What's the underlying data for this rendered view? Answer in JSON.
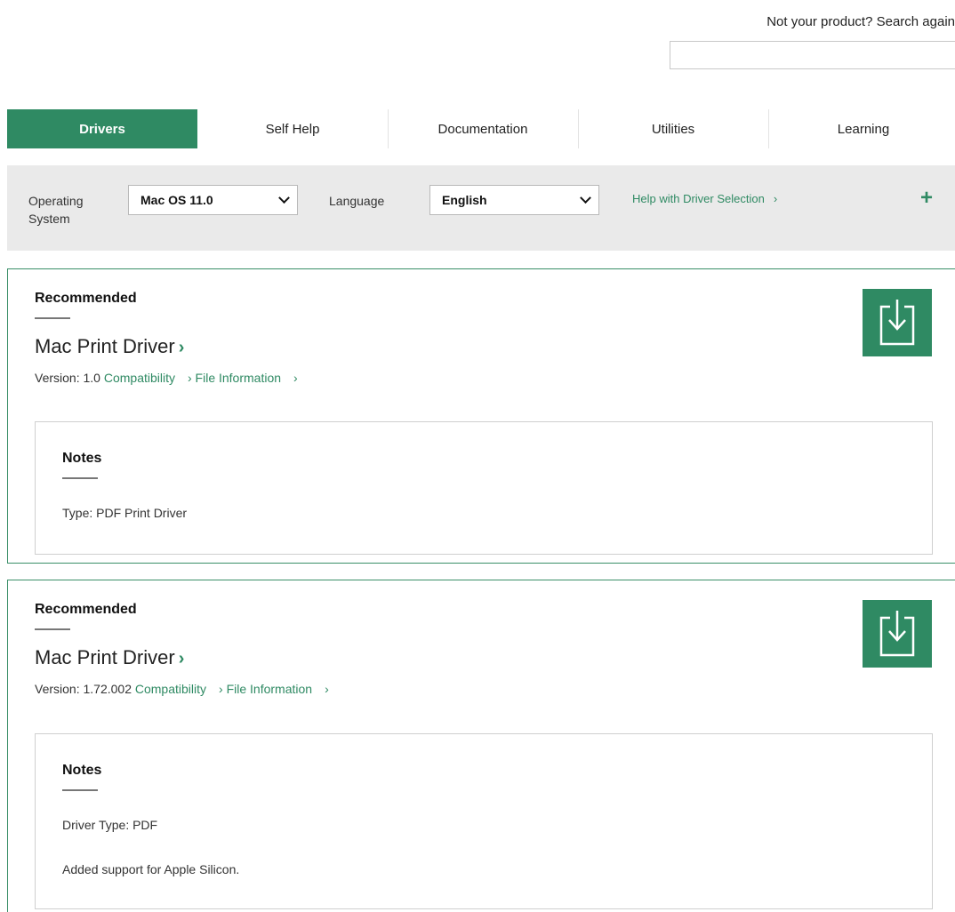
{
  "search": {
    "prompt": "Not your product? Search again",
    "value": ""
  },
  "tabs": [
    {
      "label": "Drivers",
      "active": true
    },
    {
      "label": "Self Help",
      "active": false
    },
    {
      "label": "Documentation",
      "active": false
    },
    {
      "label": "Utilities",
      "active": false
    },
    {
      "label": "Learning",
      "active": false
    }
  ],
  "filters": {
    "os_label": "Operating System",
    "os_value": "Mac OS 11.0",
    "language_label": "Language",
    "language_value": "English",
    "help_link": "Help with Driver Selection",
    "help_arrow": "›",
    "plus": "+"
  },
  "drivers": [
    {
      "heading": "Recommended",
      "title": "Mac Print Driver",
      "title_arrow": "›",
      "version_label": "Version:",
      "version": "1.0",
      "compat_link": "Compatibility",
      "file_info_link": "File Information",
      "link_arrow": "›",
      "notes_heading": "Notes",
      "notes": [
        "Type: PDF Print Driver"
      ]
    },
    {
      "heading": "Recommended",
      "title": "Mac Print Driver",
      "title_arrow": "›",
      "version_label": "Version:",
      "version": "1.72.002",
      "compat_link": "Compatibility",
      "file_info_link": "File Information",
      "link_arrow": "›",
      "notes_heading": "Notes",
      "notes": [
        "Driver Type: PDF",
        "Added support for Apple Silicon."
      ]
    }
  ],
  "icons": {
    "download": "download-icon",
    "chevron": "chevron-down-icon",
    "plus": "plus-icon"
  },
  "colors": {
    "brand_green": "#2f8a63",
    "filter_bg": "#eaeaea"
  }
}
